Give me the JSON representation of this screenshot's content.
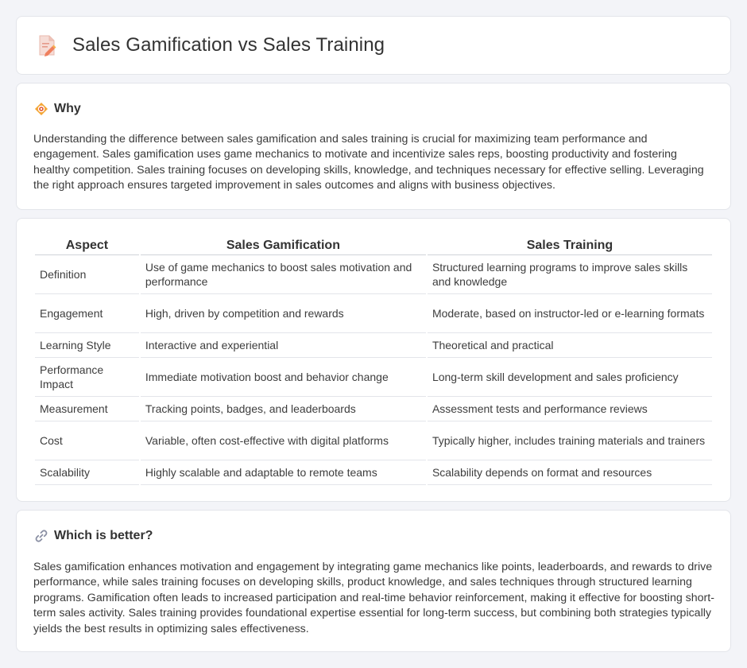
{
  "header": {
    "title": "Sales Gamification vs Sales Training",
    "icon": "document-edit-icon"
  },
  "why": {
    "heading": "Why",
    "icon": "bullseye-diamond-icon",
    "text": "Understanding the difference between sales gamification and sales training is crucial for maximizing team performance and engagement. Sales gamification uses game mechanics to motivate and incentivize sales reps, boosting productivity and fostering healthy competition. Sales training focuses on developing skills, knowledge, and techniques necessary for effective selling. Leveraging the right approach ensures targeted improvement in sales outcomes and aligns with business objectives."
  },
  "table": {
    "headers": [
      "Aspect",
      "Sales Gamification",
      "Sales Training"
    ],
    "rows": [
      [
        "Definition",
        "Use of game mechanics to boost sales motivation and performance",
        "Structured learning programs to improve sales skills and knowledge"
      ],
      [
        "Engagement",
        "High, driven by competition and rewards",
        "Moderate, based on instructor-led or e-learning formats"
      ],
      [
        "Learning Style",
        "Interactive and experiential",
        "Theoretical and practical"
      ],
      [
        "Performance Impact",
        "Immediate motivation boost and behavior change",
        "Long-term skill development and sales proficiency"
      ],
      [
        "Measurement",
        "Tracking points, badges, and leaderboards",
        "Assessment tests and performance reviews"
      ],
      [
        "Cost",
        "Variable, often cost-effective with digital platforms",
        "Typically higher, includes training materials and trainers"
      ],
      [
        "Scalability",
        "Highly scalable and adaptable to remote teams",
        "Scalability depends on format and resources"
      ]
    ]
  },
  "better": {
    "heading": "Which is better?",
    "icon": "link-icon",
    "text": "Sales gamification enhances motivation and engagement by integrating game mechanics like points, leaderboards, and rewards to drive performance, while sales training focuses on developing skills, product knowledge, and sales techniques through structured learning programs. Gamification often leads to increased participation and real-time behavior reinforcement, making it effective for boosting short-term sales activity. Sales training provides foundational expertise essential for long-term success, but combining both strategies typically yields the best results in optimizing sales effectiveness."
  }
}
